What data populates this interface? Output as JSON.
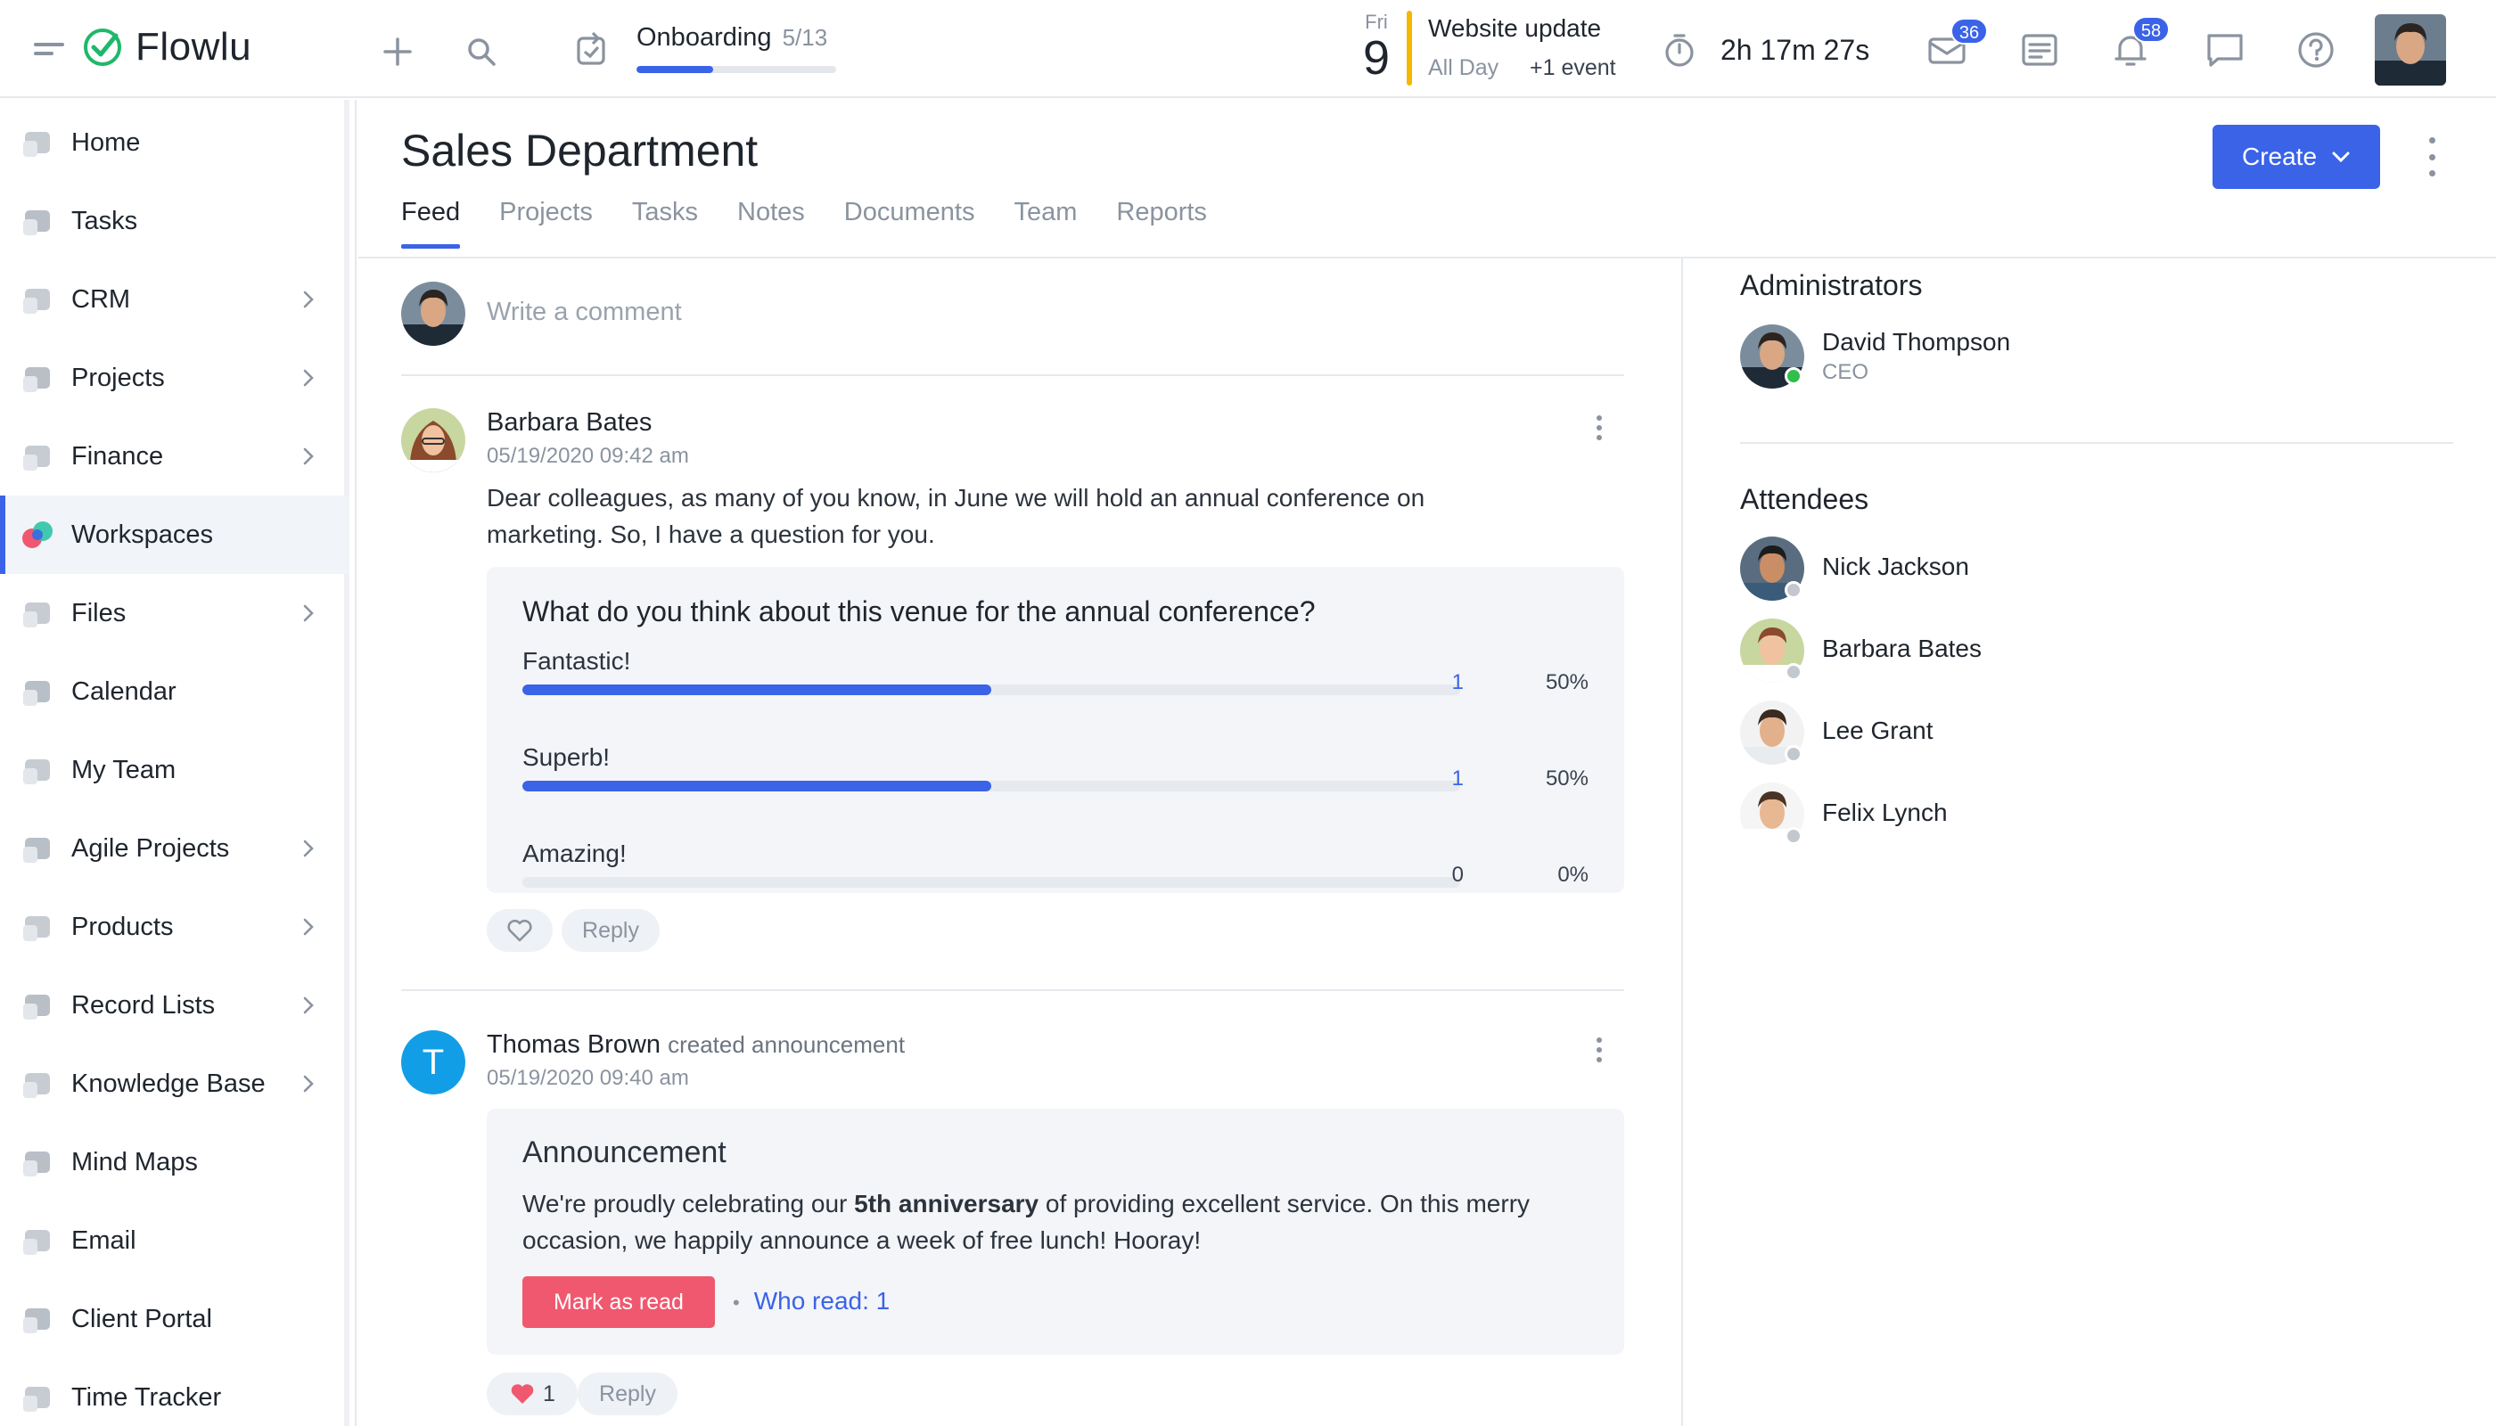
{
  "app": {
    "name": "Flowlu"
  },
  "topbar": {
    "onboarding": {
      "label": "Onboarding",
      "count": "5/13",
      "progress": 0.385
    },
    "calendar": {
      "weekday": "Fri",
      "day": "9"
    },
    "event": {
      "title": "Website update",
      "when": "All Day",
      "more": "+1 event"
    },
    "timer": "2h 17m 27s",
    "mail_badge": "36",
    "notifications_badge": "58",
    "accent": "#3a63e8",
    "event_color": "#f5b700"
  },
  "sidebar": {
    "items": [
      {
        "label": "Home",
        "icon": "home-icon",
        "has_children": false
      },
      {
        "label": "Tasks",
        "icon": "tasks-icon",
        "has_children": false
      },
      {
        "label": "CRM",
        "icon": "crm-icon",
        "has_children": true
      },
      {
        "label": "Projects",
        "icon": "projects-icon",
        "has_children": true
      },
      {
        "label": "Finance",
        "icon": "finance-icon",
        "has_children": true
      },
      {
        "label": "Workspaces",
        "icon": "workspaces-icon",
        "has_children": false,
        "active": true
      },
      {
        "label": "Files",
        "icon": "files-icon",
        "has_children": true
      },
      {
        "label": "Calendar",
        "icon": "calendar-icon",
        "has_children": false
      },
      {
        "label": "My Team",
        "icon": "team-icon",
        "has_children": false
      },
      {
        "label": "Agile Projects",
        "icon": "agile-icon",
        "has_children": true
      },
      {
        "label": "Products",
        "icon": "products-icon",
        "has_children": true
      },
      {
        "label": "Record Lists",
        "icon": "record-lists-icon",
        "has_children": true
      },
      {
        "label": "Knowledge Base",
        "icon": "knowledge-base-icon",
        "has_children": true
      },
      {
        "label": "Mind Maps",
        "icon": "mind-maps-icon",
        "has_children": false
      },
      {
        "label": "Email",
        "icon": "email-icon",
        "has_children": false
      },
      {
        "label": "Client Portal",
        "icon": "client-portal-icon",
        "has_children": false
      },
      {
        "label": "Time Tracker",
        "icon": "time-tracker-icon",
        "has_children": false
      }
    ]
  },
  "page": {
    "title": "Sales Department",
    "tabs": [
      "Feed",
      "Projects",
      "Tasks",
      "Notes",
      "Documents",
      "Team",
      "Reports"
    ],
    "active_tab": "Feed",
    "create_label": "Create"
  },
  "feed": {
    "comment_placeholder": "Write a comment",
    "posts": [
      {
        "author": "Barbara Bates",
        "timestamp": "05/19/2020 09:42 am",
        "text": "Dear colleagues, as many of you know, in June we will hold an annual conference on marketing. So, I have a question for you.",
        "poll": {
          "question": "What do you think about this venue for the annual conference?",
          "options": [
            {
              "label": "Fantastic!",
              "votes": "1",
              "percent": "50%",
              "fraction": 0.5
            },
            {
              "label": "Superb!",
              "votes": "1",
              "percent": "50%",
              "fraction": 0.5
            },
            {
              "label": "Amazing!",
              "votes": "0",
              "percent": "0%",
              "fraction": 0
            }
          ]
        },
        "reply_label": "Reply"
      },
      {
        "author": "Thomas Brown",
        "action": "created announcement",
        "timestamp": "05/19/2020 09:40 am",
        "avatar_letter": "T",
        "announcement": {
          "title": "Announcement",
          "text_before": "We're proudly celebrating our ",
          "text_bold": "5th anniversary",
          "text_after": " of providing excellent service. On this merry occasion, we happily announce a week of free lunch! Hooray!",
          "mark_read_label": "Mark as read",
          "who_read": "Who read: 1"
        },
        "likes": "1",
        "reply_label": "Reply"
      }
    ]
  },
  "right_panel": {
    "administrators_heading": "Administrators",
    "administrators": [
      {
        "name": "David Thompson",
        "role": "CEO",
        "online": true
      }
    ],
    "attendees_heading": "Attendees",
    "attendees": [
      {
        "name": "Nick Jackson",
        "online": false
      },
      {
        "name": "Barbara Bates",
        "online": false
      },
      {
        "name": "Lee Grant",
        "online": false
      },
      {
        "name": "Felix Lynch",
        "online": false
      }
    ]
  }
}
